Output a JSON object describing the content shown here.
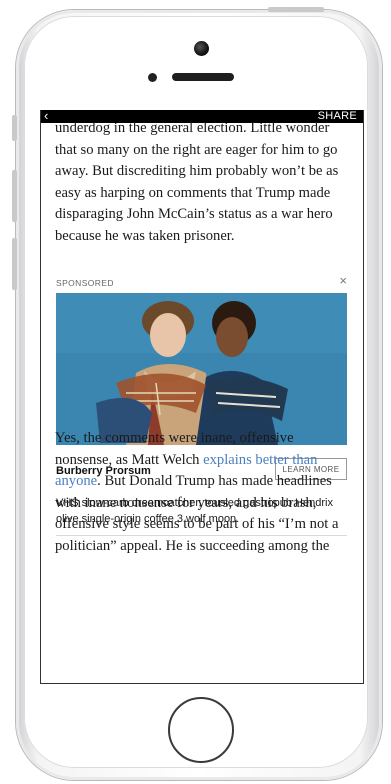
{
  "topbar": {
    "back_icon": "‹",
    "share_label": "SHARE"
  },
  "article": {
    "paragraph1": "underdog in the general election. Little wonder that so many on the right are eager for him to go away. But discrediting him probably won’t be as easy as harping on comments that Trump made disparaging John McCain’s status as a war hero because he was taken prisoner.",
    "paragraph2_before_link": "Yes, the comments were inane, offensive nonsense, as Matt Welch ",
    "paragraph2_link": "explains better than anyone",
    "paragraph2_after_link": ". But Donald Trump has made headlines with inane nonsense for years, and his brash, offensive style seems to be part of his “I’m not a politician” appeal. He is succeeding among the"
  },
  "ad": {
    "sponsored_label": "SPONSORED",
    "close_icon": "×",
    "brand": "Burberry Prorsum",
    "cta_label": "LEARN MORE",
    "description": "VHS slow-carb dreamcatcher, tousled gastropub Hendrix olive single-origin coffee 3 wolf moon."
  },
  "colors": {
    "link": "#4a7fc1",
    "ad_background": "#3a86b1",
    "topbar": "#000000"
  }
}
